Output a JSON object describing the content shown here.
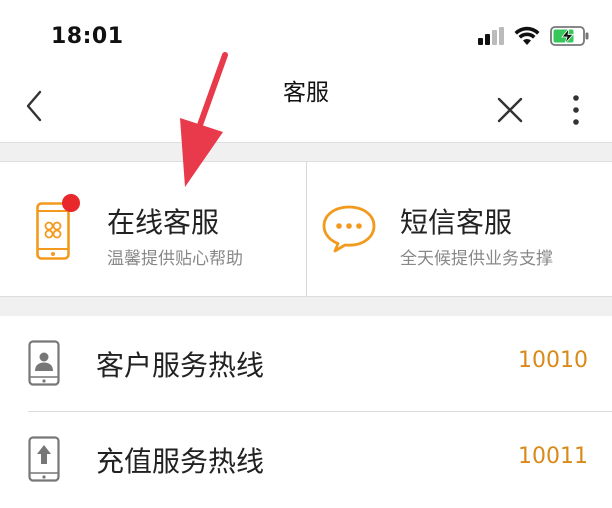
{
  "status_bar": {
    "time": "18:01",
    "icons": [
      "signal-icon",
      "wifi-icon",
      "battery-charging-icon"
    ]
  },
  "nav": {
    "title": "客服",
    "icons": [
      "back-chevron-icon",
      "close-icon",
      "more-vertical-icon"
    ]
  },
  "services": [
    {
      "title": "在线客服",
      "subtitle": "温馨提供贴心帮助",
      "icon": "phone-unicom-icon",
      "has_badge": true
    },
    {
      "title": "短信客服",
      "subtitle": "全天候提供业务支撑",
      "icon": "chat-bubble-icon"
    }
  ],
  "hotlines": [
    {
      "label": "客户服务热线",
      "number": "10010",
      "icon": "phone-person-icon"
    },
    {
      "label": "充值服务热线",
      "number": "10011",
      "icon": "phone-arrow-up-icon"
    }
  ],
  "colors": {
    "accent_orange": "#f39a1e",
    "number_orange": "#d98a1b",
    "badge_red": "#e8282b",
    "annotation_red": "#e83a4a"
  }
}
